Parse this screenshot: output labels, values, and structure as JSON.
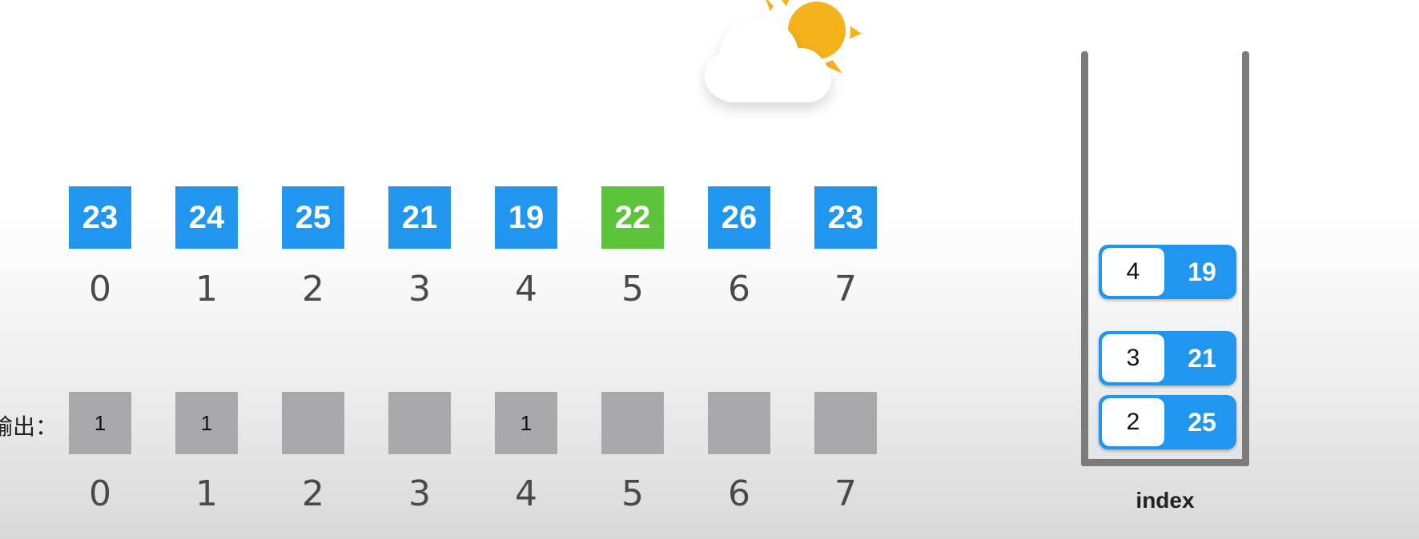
{
  "temperatures": [
    {
      "value": "23",
      "color": "#2196ee"
    },
    {
      "value": "24",
      "color": "#2196ee"
    },
    {
      "value": "25",
      "color": "#2196ee"
    },
    {
      "value": "21",
      "color": "#2196ee"
    },
    {
      "value": "19",
      "color": "#2196ee"
    },
    {
      "value": "22",
      "color": "#5cc43b"
    },
    {
      "value": "26",
      "color": "#2196ee"
    },
    {
      "value": "23",
      "color": "#2196ee"
    }
  ],
  "indices": [
    "0",
    "1",
    "2",
    "3",
    "4",
    "5",
    "6",
    "7"
  ],
  "output": {
    "label": "输出：",
    "values": [
      "1",
      "1",
      "",
      "",
      "1",
      "",
      "",
      ""
    ]
  },
  "stack": {
    "title": "index",
    "items": [
      {
        "index": "4",
        "value": "19"
      },
      {
        "index": "3",
        "value": "21"
      },
      {
        "index": "2",
        "value": "25"
      }
    ]
  },
  "icons": [
    "sun-icon",
    "cloud-icon"
  ]
}
